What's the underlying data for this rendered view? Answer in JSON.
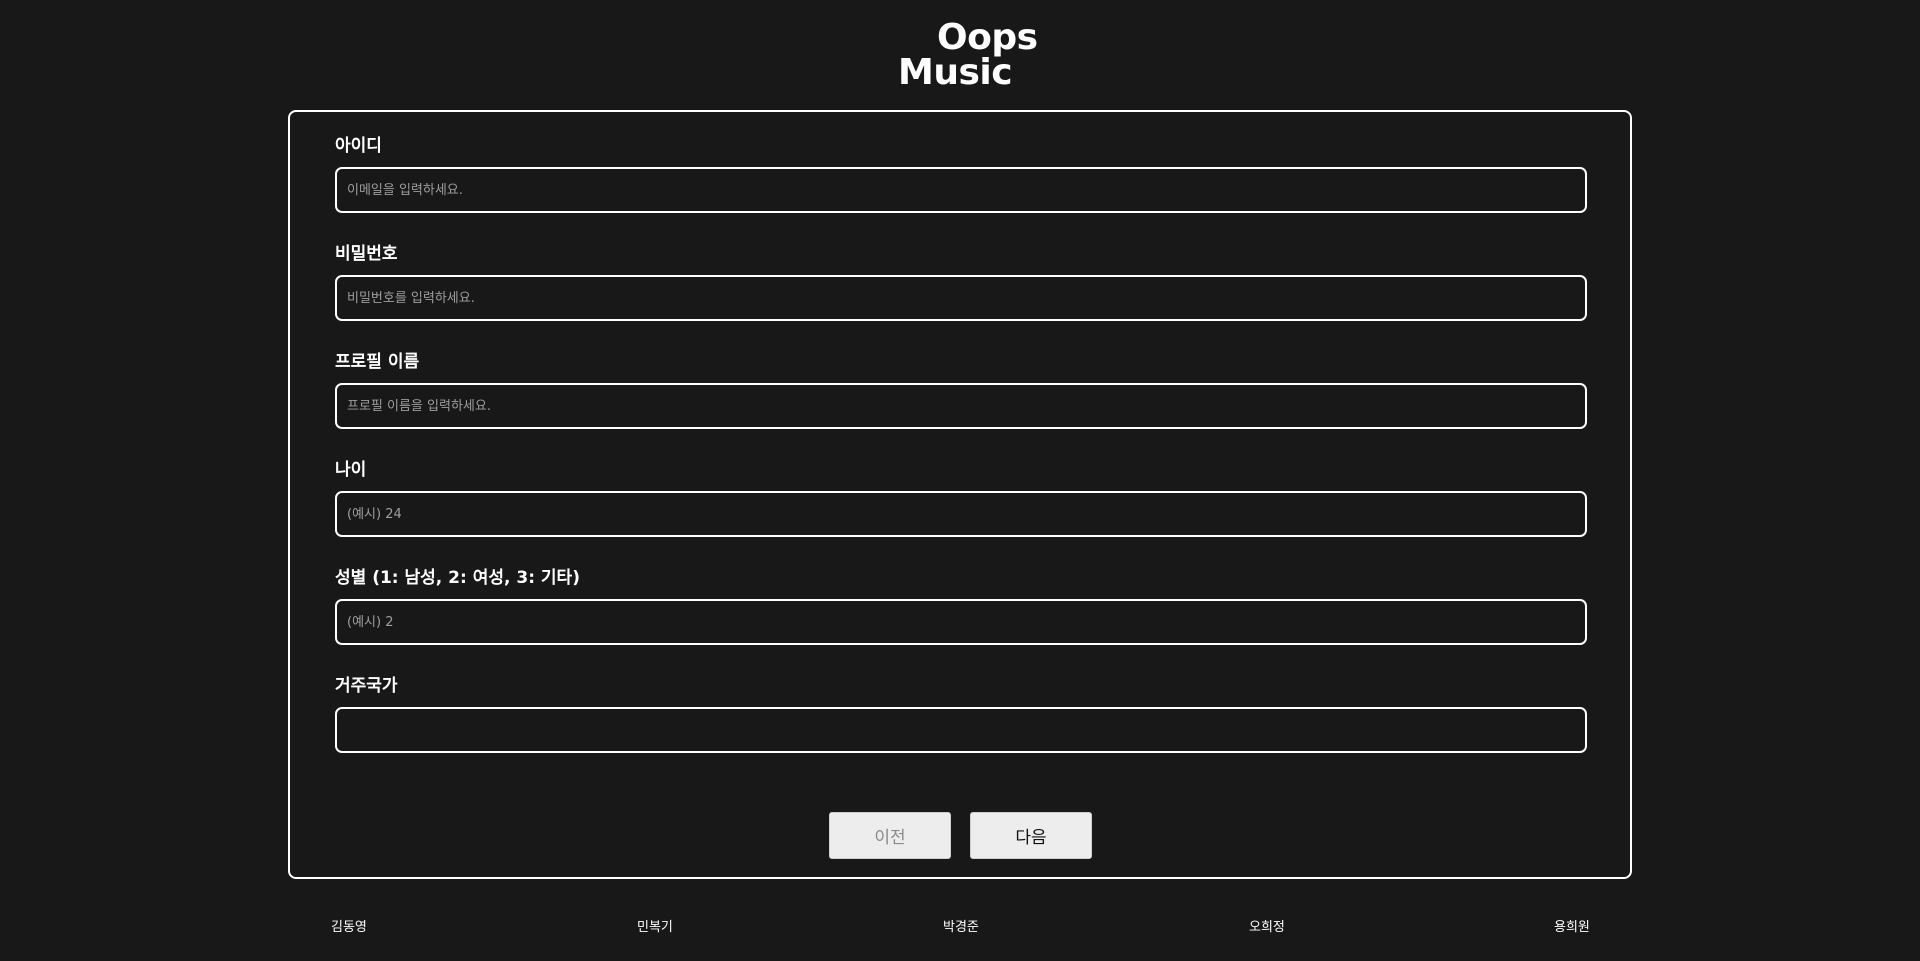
{
  "logo": {
    "line1": "Oops",
    "line2": "Music"
  },
  "form": {
    "fields": [
      {
        "label": "아이디",
        "placeholder": "이메일을 입력하세요.",
        "value": ""
      },
      {
        "label": "비밀번호",
        "placeholder": "비밀번호를 입력하세요.",
        "value": ""
      },
      {
        "label": "프로필 이름",
        "placeholder": "프로필 이름을 입력하세요.",
        "value": ""
      },
      {
        "label": "나이",
        "placeholder": "(예시) 24",
        "value": ""
      },
      {
        "label": "성별 (1: 남성, 2: 여성, 3: 기타)",
        "placeholder": "(예시) 2",
        "value": ""
      },
      {
        "label": "거주국가",
        "placeholder": "",
        "value": ""
      }
    ],
    "prev_label": "이전",
    "next_label": "다음"
  },
  "footer": {
    "names": [
      "김동영",
      "민복기",
      "박경준",
      "오희정",
      "용희원"
    ]
  }
}
